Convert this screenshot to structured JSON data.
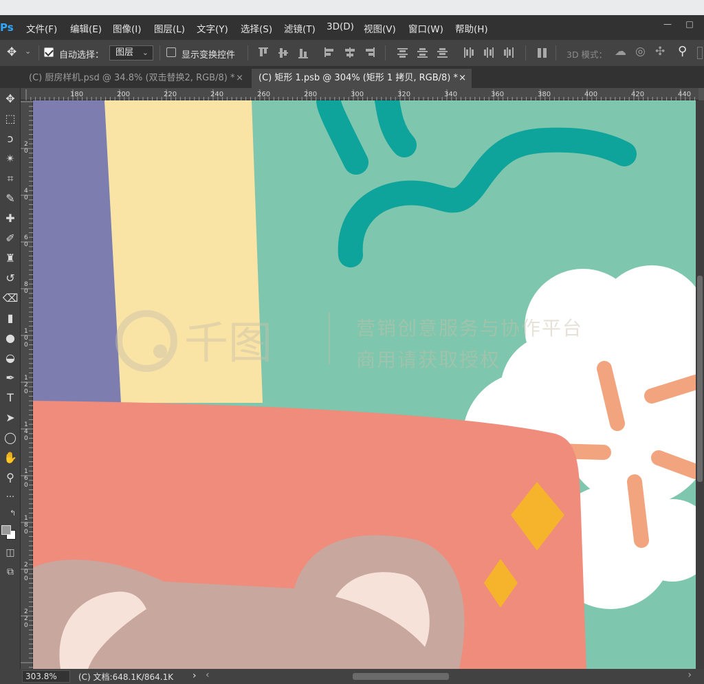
{
  "app": {
    "logo": "Ps"
  },
  "menu": [
    "文件(F)",
    "编辑(E)",
    "图像(I)",
    "图层(L)",
    "文字(Y)",
    "选择(S)",
    "滤镜(T)",
    "3D(D)",
    "视图(V)",
    "窗口(W)",
    "帮助(H)"
  ],
  "window_controls": {
    "minimize": "—",
    "restore": "□"
  },
  "options": {
    "auto_select_label": "自动选择：",
    "auto_select_checked": true,
    "auto_select_target": "图层",
    "show_transform_label": "显示变换控件",
    "show_transform_checked": false,
    "mode_3d_label": "3D 模式："
  },
  "tabs": [
    {
      "label": "(C) 厨房样机.psd @ 34.8% (双击替换2, RGB/8) *",
      "active": false,
      "close": "×"
    },
    {
      "label": "(C) 矩形 1.psb @ 304% (矩形 1 拷贝, RGB/8) *",
      "active": true,
      "close": "×"
    }
  ],
  "tools": [
    {
      "name": "move-tool",
      "glyph": "✥"
    },
    {
      "name": "marquee-tool",
      "glyph": "⬚"
    },
    {
      "name": "lasso-tool",
      "glyph": "ↄ"
    },
    {
      "name": "magic-wand-tool",
      "glyph": "✴"
    },
    {
      "name": "crop-tool",
      "glyph": "⌗"
    },
    {
      "name": "eyedropper-tool",
      "glyph": "✎"
    },
    {
      "name": "healing-brush-tool",
      "glyph": "✚"
    },
    {
      "name": "brush-tool",
      "glyph": "✐"
    },
    {
      "name": "clone-stamp-tool",
      "glyph": "♜"
    },
    {
      "name": "history-brush-tool",
      "glyph": "↺"
    },
    {
      "name": "eraser-tool",
      "glyph": "⌫"
    },
    {
      "name": "gradient-tool",
      "glyph": "▮"
    },
    {
      "name": "blur-tool",
      "glyph": "●"
    },
    {
      "name": "dodge-tool",
      "glyph": "◒"
    },
    {
      "name": "pen-tool",
      "glyph": "✒"
    },
    {
      "name": "type-tool",
      "glyph": "T"
    },
    {
      "name": "path-selection-tool",
      "glyph": "➤"
    },
    {
      "name": "ellipse-tool",
      "glyph": "◯"
    },
    {
      "name": "hand-tool",
      "glyph": "✋"
    },
    {
      "name": "zoom-tool",
      "glyph": "⚲"
    },
    {
      "name": "more-tools",
      "glyph": "···"
    }
  ],
  "ruler": {
    "top": [
      "180",
      "200",
      "220",
      "240",
      "260",
      "280",
      "300",
      "320",
      "340",
      "360",
      "380",
      "400",
      "420",
      "440"
    ],
    "left": [
      "2 0",
      "4 0",
      "6 0",
      "8 0",
      "1 0 0",
      "1 2 0",
      "1 4 0",
      "1 6 0",
      "1 8 0",
      "2 0 0",
      "2 2 0"
    ]
  },
  "canvas": {
    "watermark_line1": "营销创意服务与协作平台",
    "watermark_line2": "商用请获取授权",
    "watermark_logo": "千图",
    "colors": {
      "purple": "#7d7eaf",
      "yellow": "#f9e3a5",
      "mint": "#7ec6ad",
      "teal": "#0ea39b",
      "coral": "#ef8c7b",
      "white": "#ffffff",
      "orange": "#f2a47e",
      "gold": "#f6b42c",
      "bear": "#c8a89e",
      "bear_ear": "#f7e2da"
    }
  },
  "status": {
    "zoom": "303.8%",
    "doc_info": "(C) 文档:648.1K/864.1K",
    "nav_arrow": "›",
    "scroll_left": "‹",
    "scroll_right": "›"
  }
}
